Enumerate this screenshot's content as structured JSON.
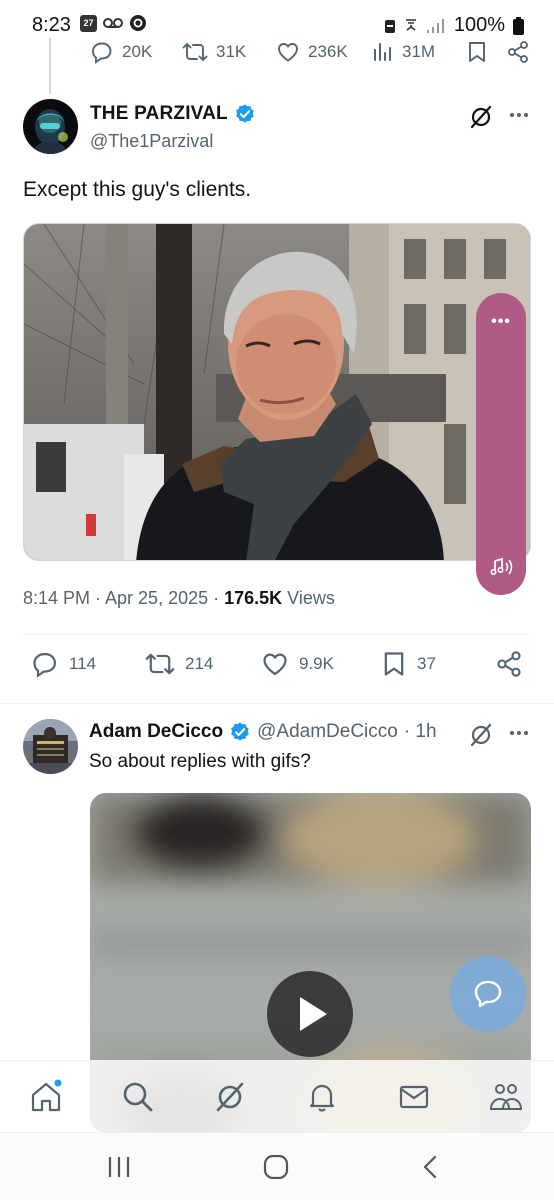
{
  "status_bar": {
    "time": "8:23",
    "calendar_day": "27",
    "battery": "100%"
  },
  "top_stats": {
    "replies": "20K",
    "reposts": "31K",
    "likes": "236K",
    "views": "31M"
  },
  "main_tweet": {
    "display_name": "THE PARZIVAL",
    "handle": "@The1Parzival",
    "text": "Except this guy's clients.",
    "time_date": "8:14 PM · Apr 25, 2025 · ",
    "views_count": "176.5K",
    "views_label": " Views",
    "actions": {
      "replies": "114",
      "reposts": "214",
      "likes": "9.9K",
      "bookmarks": "37"
    }
  },
  "floating_pill": {
    "dots": "•••"
  },
  "reply_tweet": {
    "display_name": "Adam DeCicco",
    "handle": "@AdamDeCicco",
    "time": "· 1h",
    "text": "So about replies with gifs?"
  },
  "bottom_nav": [
    "home",
    "search",
    "grok",
    "notifications",
    "messages",
    "communities"
  ],
  "colors": {
    "accent": "#1d9bf0",
    "pill": "#b05b85",
    "text": "#0f1419",
    "secondary": "#536471"
  }
}
